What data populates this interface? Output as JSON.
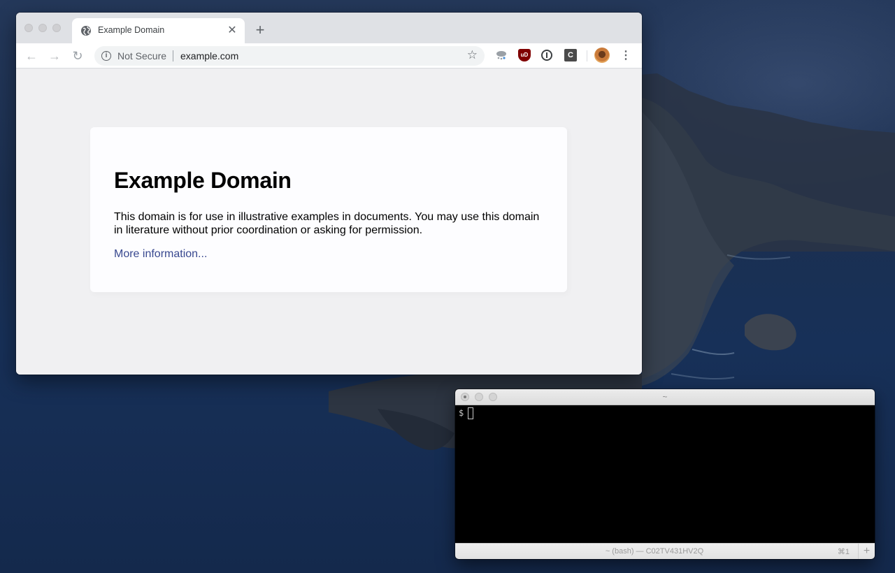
{
  "browser": {
    "tab": {
      "title": "Example Domain",
      "favicon": "globe-icon",
      "close_icon": "close-icon"
    },
    "new_tab_icon": "plus-icon",
    "nav": {
      "back_icon": "arrow-left-icon",
      "forward_icon": "arrow-right-icon",
      "reload_icon": "reload-icon"
    },
    "omnibox": {
      "security_label": "Not Secure",
      "url": "example.com",
      "bookmark_icon": "star-icon"
    },
    "extensions": [
      "weather-extension-icon",
      "ublock-icon",
      "onepassword-icon",
      "c-extension-icon"
    ],
    "extension_labels": {
      "ublock": "uD",
      "c_extension": "C"
    },
    "profile_icon": "avatar",
    "menu_icon": "kebab-menu-icon"
  },
  "page": {
    "heading": "Example Domain",
    "paragraph": "This domain is for use in illustrative examples in documents. You may use this domain in literature without prior coordination or asking for permission.",
    "link_text": "More information..."
  },
  "terminal": {
    "title": "~",
    "prompt": "$",
    "status_label": "~ (bash) — C02TV431HV2Q",
    "shortcut": "⌘1",
    "add_label": "+"
  },
  "colors": {
    "link": "#38488f",
    "page_background": "#f0f0f2",
    "ublock_red": "#800000"
  }
}
